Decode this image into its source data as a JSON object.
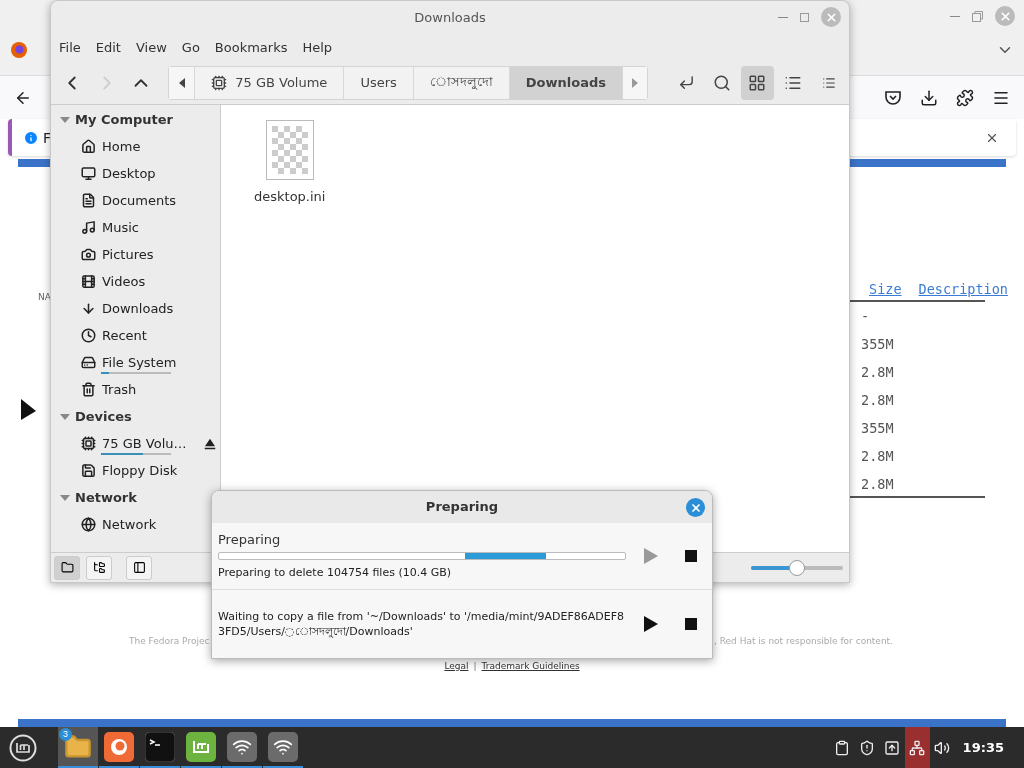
{
  "browser": {
    "notification": {
      "text": "F"
    },
    "page": {
      "side_text": "NA",
      "table": {
        "columns": [
          "Size",
          "Description"
        ],
        "rows": [
          {
            "column_1": "-"
          },
          {
            "column_1": "355M"
          },
          {
            "column_1": "2.8M"
          },
          {
            "column_1": "2.8M"
          },
          {
            "column_1": "355M"
          },
          {
            "column_1": "2.8M"
          },
          {
            "column_1": "2.8M"
          }
        ]
      },
      "footer": {
        "notice_start": "The Fedora Projec",
        "notice_end": ", Red Hat is not responsible for content.",
        "links": [
          "Legal",
          "Trademark Guidelines"
        ],
        "separator": "|"
      }
    }
  },
  "file_manager": {
    "title": "Downloads",
    "menu": [
      "File",
      "Edit",
      "View",
      "Go",
      "Bookmarks",
      "Help"
    ],
    "nav": [
      {
        "kind": "back",
        "disabled": false
      },
      {
        "kind": "forward",
        "disabled": true
      },
      {
        "kind": "up",
        "disabled": false
      }
    ],
    "breadcrumb": [
      {
        "label": "75 GB Volume",
        "kind": "drive",
        "selected": false
      },
      {
        "label": "Users",
        "kind": "folder",
        "selected": false
      },
      {
        "label": "◌োসদলুদো",
        "kind": "folder",
        "selected": false
      },
      {
        "label": "Downloads",
        "kind": "folder",
        "selected": true
      }
    ],
    "view_buttons": [
      {
        "kind": "icons",
        "selected": true
      },
      {
        "kind": "list",
        "selected": false
      },
      {
        "kind": "compact",
        "selected": false
      }
    ],
    "sidebar": [
      {
        "title": "My Computer",
        "expanded": true,
        "items": [
          {
            "label": "Home",
            "kind": "home"
          },
          {
            "label": "Desktop",
            "kind": "desktop"
          },
          {
            "label": "Documents",
            "kind": "documents"
          },
          {
            "label": "Music",
            "kind": "music"
          },
          {
            "label": "Pictures",
            "kind": "pictures"
          },
          {
            "label": "Videos",
            "kind": "videos"
          },
          {
            "label": "Downloads",
            "kind": "downloads"
          },
          {
            "label": "Recent",
            "kind": "recent"
          },
          {
            "label": "File System",
            "kind": "filesystem",
            "level": 0.12
          },
          {
            "label": "Trash",
            "kind": "trash"
          }
        ]
      },
      {
        "title": "Devices",
        "expanded": true,
        "items": [
          {
            "label": "75 GB Volu…",
            "kind": "drive",
            "level": 0.6,
            "ejectable": true
          },
          {
            "label": "Floppy Disk",
            "kind": "floppy"
          }
        ]
      },
      {
        "title": "Network",
        "expanded": true,
        "items": [
          {
            "label": "Network",
            "kind": "network"
          }
        ]
      }
    ],
    "files": [
      {
        "name": "desktop.ini"
      }
    ],
    "bottom_buttons": [
      {
        "kind": "places",
        "selected": true
      },
      {
        "kind": "tree",
        "selected": false
      },
      {
        "kind": "toggle",
        "selected": false
      }
    ],
    "zoom": {
      "level": 0.5
    }
  },
  "dialog": {
    "title": "Preparing",
    "jobs": [
      {
        "heading": "Preparing",
        "indeterminate": true,
        "status": "Preparing to delete 104754 files (10.4 GB)",
        "play_disabled": true
      },
      {
        "status": "Waiting to copy a file from '~/Downloads' to '/media/mint/9ADEF86ADEF83FD5/Users/◌োসদলুদো/Downloads'",
        "play_disabled": false
      }
    ]
  },
  "taskbar": {
    "apps": [
      {
        "kind": "files",
        "badge": "3",
        "active": true,
        "running": true
      },
      {
        "kind": "firefox",
        "active": false,
        "running": true
      },
      {
        "kind": "terminal",
        "active": false,
        "running": true
      },
      {
        "kind": "mint",
        "active": false,
        "running": true
      },
      {
        "kind": "wifi",
        "active": false,
        "running": true
      },
      {
        "kind": "wifi",
        "active": false,
        "running": true
      }
    ],
    "tray": [
      {
        "kind": "clipboard",
        "highlighted": false
      },
      {
        "kind": "shield",
        "highlighted": false
      },
      {
        "kind": "eject",
        "highlighted": false
      },
      {
        "kind": "network",
        "highlighted": true
      },
      {
        "kind": "volume",
        "highlighted": false
      }
    ],
    "clock": "19:35"
  }
}
